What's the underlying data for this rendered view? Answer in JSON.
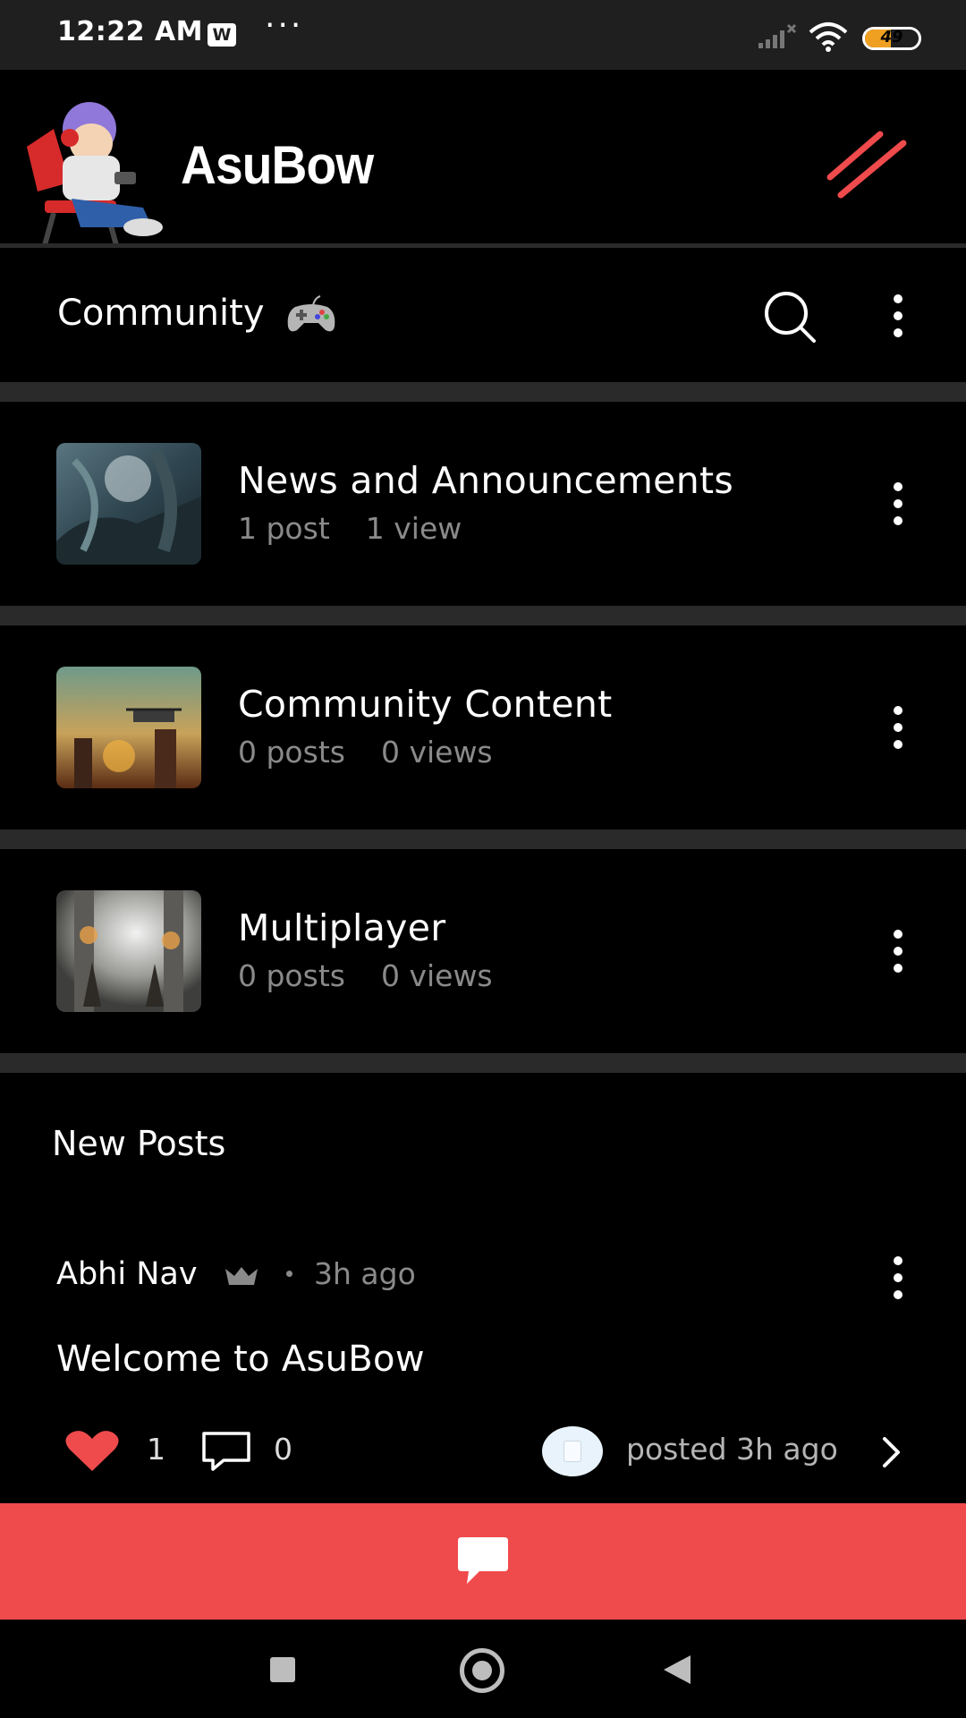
{
  "status_bar": {
    "time": "12:22 AM",
    "notification_badge": "W",
    "more_dots": "···",
    "battery_level": "49",
    "icons": [
      "signal-icon",
      "wifi-icon",
      "battery-icon"
    ]
  },
  "header": {
    "app_title": "AsuBow",
    "logo": "gamer-avatar-logo",
    "menu_icon": "slash-menu-icon",
    "accent_color": "#ef4a4c"
  },
  "section": {
    "title": "Community",
    "title_icon": "gamepad-icon",
    "search_icon": "search-icon",
    "more_icon": "more-vertical-icon"
  },
  "categories": [
    {
      "name": "News and Announcements",
      "posts": "1 post",
      "views": "1 view",
      "thumb": "sci-fi-battle-thumbnail"
    },
    {
      "name": "Community Content",
      "posts": "0 posts",
      "views": "0 views",
      "thumb": "drone-city-thumbnail"
    },
    {
      "name": "Multiplayer",
      "posts": "0 posts",
      "views": "0 views",
      "thumb": "duel-gate-thumbnail"
    }
  ],
  "new_posts": {
    "title": "New Posts",
    "post": {
      "author": "Abhi Nav",
      "author_badge": "crown-icon",
      "time": "3h ago",
      "title": "Welcome to AsuBow",
      "likes": "1",
      "comments": "0",
      "posted_text": "posted 3h ago"
    }
  },
  "bottom": {
    "chat_icon": "chat-bubble-icon",
    "chat_bar_color": "#ef4a4c"
  },
  "nav": [
    "recents-button",
    "home-button",
    "back-button"
  ]
}
